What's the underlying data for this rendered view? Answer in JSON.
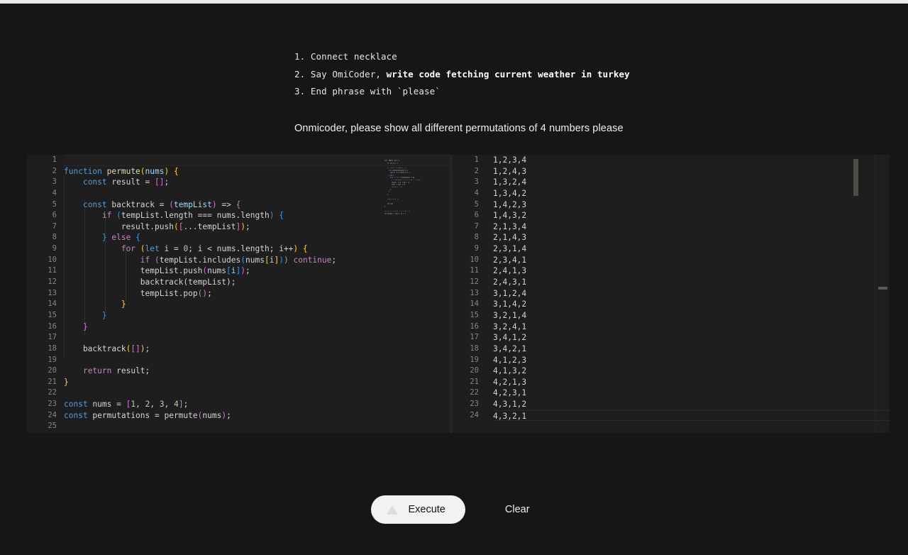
{
  "page": {
    "background_color": "#161616",
    "editor_background": "#1e1e1e"
  },
  "instructions": [
    {
      "number": "1.",
      "text": "Connect necklace",
      "bold_text": ""
    },
    {
      "number": "2.",
      "text": "Say OmiCoder, ",
      "bold_text": "write code fetching current weather in turkey"
    },
    {
      "number": "3.",
      "text": "End phrase with `please`",
      "bold_text": ""
    }
  ],
  "user_prompt": "Onmicoder, please show all different permutations of 4 numbers please",
  "code_editor": {
    "language": "javascript",
    "first_line_number": 1,
    "last_line_number": 25,
    "active_line": 1,
    "lines": [
      {
        "n": "1",
        "tokens": []
      },
      {
        "n": "2",
        "tokens": [
          {
            "t": "function",
            "c": "t-kw"
          },
          {
            "t": " ",
            "c": "t-pl"
          },
          {
            "t": "permute",
            "c": "t-fn"
          },
          {
            "t": "(",
            "c": "t-br1"
          },
          {
            "t": "nums",
            "c": "t-var"
          },
          {
            "t": ")",
            "c": "t-br1"
          },
          {
            "t": " ",
            "c": "t-pl"
          },
          {
            "t": "{",
            "c": "t-br1"
          }
        ]
      },
      {
        "n": "3",
        "tokens": [
          {
            "t": "    ",
            "c": "t-pl"
          },
          {
            "t": "const",
            "c": "t-kw"
          },
          {
            "t": " result ",
            "c": "t-pl"
          },
          {
            "t": "=",
            "c": "t-pl"
          },
          {
            "t": " ",
            "c": "t-pl"
          },
          {
            "t": "[]",
            "c": "t-br2"
          },
          {
            "t": ";",
            "c": "t-pl"
          }
        ]
      },
      {
        "n": "4",
        "tokens": []
      },
      {
        "n": "5",
        "tokens": [
          {
            "t": "    ",
            "c": "t-pl"
          },
          {
            "t": "const",
            "c": "t-kw"
          },
          {
            "t": " backtrack ",
            "c": "t-pl"
          },
          {
            "t": "=",
            "c": "t-pl"
          },
          {
            "t": " ",
            "c": "t-pl"
          },
          {
            "t": "(",
            "c": "t-br2"
          },
          {
            "t": "tempList",
            "c": "t-var"
          },
          {
            "t": ")",
            "c": "t-br2"
          },
          {
            "t": " => ",
            "c": "t-pl"
          },
          {
            "t": "{",
            "c": "t-br2"
          }
        ]
      },
      {
        "n": "6",
        "tokens": [
          {
            "t": "        ",
            "c": "t-pl"
          },
          {
            "t": "if",
            "c": "t-ctl"
          },
          {
            "t": " ",
            "c": "t-pl"
          },
          {
            "t": "(",
            "c": "t-br3"
          },
          {
            "t": "tempList.length === nums.length",
            "c": "t-pl"
          },
          {
            "t": ")",
            "c": "t-br3"
          },
          {
            "t": " ",
            "c": "t-pl"
          },
          {
            "t": "{",
            "c": "t-br3"
          }
        ]
      },
      {
        "n": "7",
        "tokens": [
          {
            "t": "            result.",
            "c": "t-pl"
          },
          {
            "t": "push",
            "c": "t-pl"
          },
          {
            "t": "(",
            "c": "t-br1"
          },
          {
            "t": "[",
            "c": "t-br2"
          },
          {
            "t": "...tempList",
            "c": "t-pl"
          },
          {
            "t": "]",
            "c": "t-br2"
          },
          {
            "t": ")",
            "c": "t-br1"
          },
          {
            "t": ";",
            "c": "t-pl"
          }
        ]
      },
      {
        "n": "8",
        "tokens": [
          {
            "t": "        ",
            "c": "t-pl"
          },
          {
            "t": "}",
            "c": "t-br3"
          },
          {
            "t": " ",
            "c": "t-pl"
          },
          {
            "t": "else",
            "c": "t-ctl"
          },
          {
            "t": " ",
            "c": "t-pl"
          },
          {
            "t": "{",
            "c": "t-br3"
          }
        ]
      },
      {
        "n": "9",
        "tokens": [
          {
            "t": "            ",
            "c": "t-pl"
          },
          {
            "t": "for",
            "c": "t-ctl"
          },
          {
            "t": " ",
            "c": "t-pl"
          },
          {
            "t": "(",
            "c": "t-br1"
          },
          {
            "t": "let",
            "c": "t-kw"
          },
          {
            "t": " i ",
            "c": "t-pl"
          },
          {
            "t": "=",
            "c": "t-pl"
          },
          {
            "t": " ",
            "c": "t-pl"
          },
          {
            "t": "0",
            "c": "t-num"
          },
          {
            "t": "; i < nums.length; i++",
            "c": "t-pl"
          },
          {
            "t": ")",
            "c": "t-br1"
          },
          {
            "t": " ",
            "c": "t-pl"
          },
          {
            "t": "{",
            "c": "t-br1"
          }
        ]
      },
      {
        "n": "10",
        "tokens": [
          {
            "t": "                ",
            "c": "t-pl"
          },
          {
            "t": "if",
            "c": "t-ctl"
          },
          {
            "t": " ",
            "c": "t-pl"
          },
          {
            "t": "(",
            "c": "t-br2"
          },
          {
            "t": "tempList.includes",
            "c": "t-pl"
          },
          {
            "t": "(",
            "c": "t-br3"
          },
          {
            "t": "nums",
            "c": "t-pl"
          },
          {
            "t": "[",
            "c": "t-br1"
          },
          {
            "t": "i",
            "c": "t-var"
          },
          {
            "t": "]",
            "c": "t-br1"
          },
          {
            "t": ")",
            "c": "t-br3"
          },
          {
            "t": ")",
            "c": "t-br2"
          },
          {
            "t": " ",
            "c": "t-pl"
          },
          {
            "t": "continue",
            "c": "t-ctl"
          },
          {
            "t": ";",
            "c": "t-pl"
          }
        ]
      },
      {
        "n": "11",
        "tokens": [
          {
            "t": "                tempList.push",
            "c": "t-pl"
          },
          {
            "t": "(",
            "c": "t-br2"
          },
          {
            "t": "nums",
            "c": "t-pl"
          },
          {
            "t": "[",
            "c": "t-br3"
          },
          {
            "t": "i",
            "c": "t-var"
          },
          {
            "t": "]",
            "c": "t-br3"
          },
          {
            "t": ")",
            "c": "t-br2"
          },
          {
            "t": ";",
            "c": "t-pl"
          }
        ]
      },
      {
        "n": "12",
        "tokens": [
          {
            "t": "                backtrack",
            "c": "t-pl"
          },
          {
            "t": "(",
            "c": "t-pl"
          },
          {
            "t": "tempList",
            "c": "t-pl"
          },
          {
            "t": ")",
            "c": "t-pl"
          },
          {
            "t": ";",
            "c": "t-pl"
          }
        ]
      },
      {
        "n": "13",
        "tokens": [
          {
            "t": "                tempList.pop",
            "c": "t-pl"
          },
          {
            "t": "(",
            "c": "t-br2"
          },
          {
            "t": ")",
            "c": "t-br2"
          },
          {
            "t": ";",
            "c": "t-pl"
          }
        ]
      },
      {
        "n": "14",
        "tokens": [
          {
            "t": "            ",
            "c": "t-pl"
          },
          {
            "t": "}",
            "c": "t-br1"
          }
        ]
      },
      {
        "n": "15",
        "tokens": [
          {
            "t": "        ",
            "c": "t-pl"
          },
          {
            "t": "}",
            "c": "t-br3"
          }
        ]
      },
      {
        "n": "16",
        "tokens": [
          {
            "t": "    ",
            "c": "t-pl"
          },
          {
            "t": "}",
            "c": "t-br2"
          }
        ]
      },
      {
        "n": "17",
        "tokens": []
      },
      {
        "n": "18",
        "tokens": [
          {
            "t": "    backtrack",
            "c": "t-pl"
          },
          {
            "t": "(",
            "c": "t-br1"
          },
          {
            "t": "[]",
            "c": "t-br2"
          },
          {
            "t": ")",
            "c": "t-br1"
          },
          {
            "t": ";",
            "c": "t-pl"
          }
        ]
      },
      {
        "n": "19",
        "tokens": []
      },
      {
        "n": "20",
        "tokens": [
          {
            "t": "    ",
            "c": "t-pl"
          },
          {
            "t": "return",
            "c": "t-ctl"
          },
          {
            "t": " result;",
            "c": "t-pl"
          }
        ]
      },
      {
        "n": "21",
        "tokens": [
          {
            "t": "}",
            "c": "t-br1"
          }
        ]
      },
      {
        "n": "22",
        "tokens": []
      },
      {
        "n": "23",
        "tokens": [
          {
            "t": "const",
            "c": "t-kw"
          },
          {
            "t": " nums ",
            "c": "t-pl"
          },
          {
            "t": "=",
            "c": "t-pl"
          },
          {
            "t": " ",
            "c": "t-pl"
          },
          {
            "t": "[",
            "c": "t-br2"
          },
          {
            "t": "1",
            "c": "t-num"
          },
          {
            "t": ", ",
            "c": "t-pl"
          },
          {
            "t": "2",
            "c": "t-num"
          },
          {
            "t": ", ",
            "c": "t-pl"
          },
          {
            "t": "3",
            "c": "t-num"
          },
          {
            "t": ", ",
            "c": "t-pl"
          },
          {
            "t": "4",
            "c": "t-num"
          },
          {
            "t": "]",
            "c": "t-br2"
          },
          {
            "t": ";",
            "c": "t-pl"
          }
        ]
      },
      {
        "n": "24",
        "tokens": [
          {
            "t": "const",
            "c": "t-kw"
          },
          {
            "t": " permutations ",
            "c": "t-pl"
          },
          {
            "t": "=",
            "c": "t-pl"
          },
          {
            "t": " permute",
            "c": "t-pl"
          },
          {
            "t": "(",
            "c": "t-br2"
          },
          {
            "t": "nums",
            "c": "t-pl"
          },
          {
            "t": ")",
            "c": "t-br2"
          },
          {
            "t": ";",
            "c": "t-pl"
          }
        ]
      },
      {
        "n": "25",
        "tokens": []
      }
    ]
  },
  "output_panel": {
    "active_line": 24,
    "rows": [
      {
        "n": "1",
        "value": "1,2,3,4"
      },
      {
        "n": "2",
        "value": "1,2,4,3"
      },
      {
        "n": "3",
        "value": "1,3,2,4"
      },
      {
        "n": "4",
        "value": "1,3,4,2"
      },
      {
        "n": "5",
        "value": "1,4,2,3"
      },
      {
        "n": "6",
        "value": "1,4,3,2"
      },
      {
        "n": "7",
        "value": "2,1,3,4"
      },
      {
        "n": "8",
        "value": "2,1,4,3"
      },
      {
        "n": "9",
        "value": "2,3,1,4"
      },
      {
        "n": "10",
        "value": "2,3,4,1"
      },
      {
        "n": "11",
        "value": "2,4,1,3"
      },
      {
        "n": "12",
        "value": "2,4,3,1"
      },
      {
        "n": "13",
        "value": "3,1,2,4"
      },
      {
        "n": "14",
        "value": "3,1,4,2"
      },
      {
        "n": "15",
        "value": "3,2,1,4"
      },
      {
        "n": "16",
        "value": "3,2,4,1"
      },
      {
        "n": "17",
        "value": "3,4,1,2"
      },
      {
        "n": "18",
        "value": "3,4,2,1"
      },
      {
        "n": "19",
        "value": "4,1,2,3"
      },
      {
        "n": "20",
        "value": "4,1,3,2"
      },
      {
        "n": "21",
        "value": "4,2,1,3"
      },
      {
        "n": "22",
        "value": "4,2,3,1"
      },
      {
        "n": "23",
        "value": "4,3,1,2"
      },
      {
        "n": "24",
        "value": "4,3,2,1"
      }
    ]
  },
  "buttons": {
    "execute_label": "Execute",
    "execute_icon": "triangle-up-icon",
    "clear_label": "Clear"
  }
}
